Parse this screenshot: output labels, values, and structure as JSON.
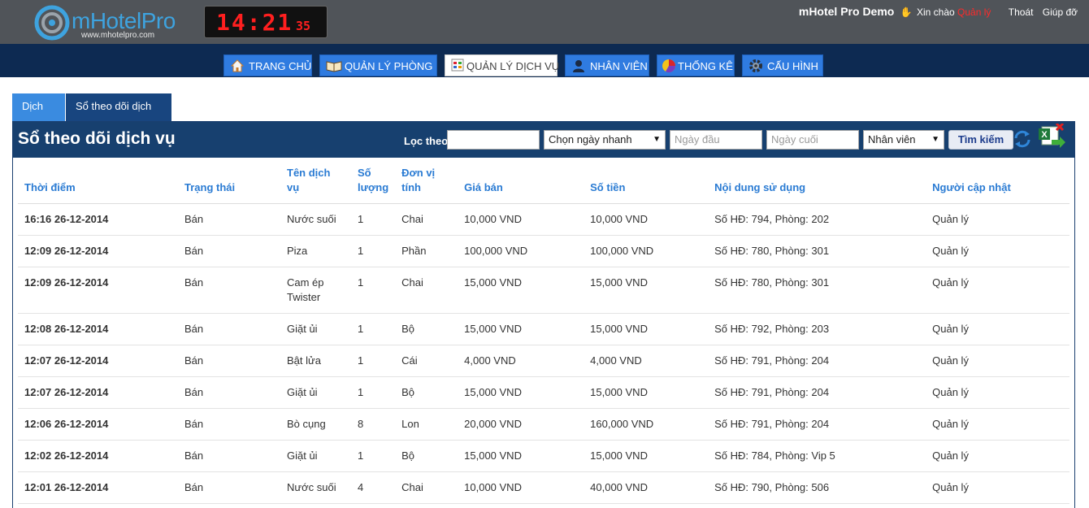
{
  "header": {
    "logo_text": "mHotelPro",
    "logo_sub": "www.mhotelpro.com",
    "clock_hm": "14:21",
    "clock_s": "35",
    "brand": "mHotel Pro Demo",
    "greeting": "Xin chào",
    "user": "Quản lý",
    "logout": "Thoát",
    "help": "Giúp đỡ"
  },
  "nav": {
    "items": [
      {
        "label": "TRANG CHỦ",
        "icon": "home-icon"
      },
      {
        "label": "QUẢN LÝ PHÒNG",
        "icon": "book-icon"
      },
      {
        "label": "QUẢN LÝ DỊCH VỤ",
        "icon": "service-icon"
      },
      {
        "label": "NHÂN VIÊN",
        "icon": "user-icon"
      },
      {
        "label": "THỐNG KÊ",
        "icon": "pie-chart-icon"
      },
      {
        "label": "CẤU HÌNH",
        "icon": "gear-icon"
      }
    ],
    "active": "QUẢN LÝ DỊCH VỤ"
  },
  "tabs": [
    {
      "label": "Dịch vụ"
    },
    {
      "label": "Sổ theo dõi dịch vụ"
    }
  ],
  "panel": {
    "title": "Sổ theo dõi dịch vụ",
    "filter_label": "Lọc theo:",
    "filter_value": "",
    "quick_date": "Chọn ngày nhanh",
    "start_placeholder": "Ngày đầu",
    "end_placeholder": "Ngày cuối",
    "staff": "Nhân viên",
    "search_label": "Tìm kiếm",
    "refresh_icon": "refresh-icon",
    "export_icon": "excel-export-icon"
  },
  "table": {
    "columns": [
      "Thời điểm",
      "Trạng thái",
      "Tên dịch vụ",
      "Số lượng",
      "Đơn vị tính",
      "Giá bán",
      "Số tiền",
      "Nội dung sử dụng",
      "Người cập nhật"
    ],
    "rows": [
      [
        "16:16 26-12-2014",
        "Bán",
        "Nước suối",
        "1",
        "Chai",
        "10,000 VND",
        "10,000 VND",
        "Số HĐ: 794, Phòng: 202",
        "Quản lý"
      ],
      [
        "12:09 26-12-2014",
        "Bán",
        "Piza",
        "1",
        "Phần",
        "100,000 VND",
        "100,000 VND",
        "Số HĐ: 780, Phòng: 301",
        "Quản lý"
      ],
      [
        "12:09 26-12-2014",
        "Bán",
        "Cam ép Twister",
        "1",
        "Chai",
        "15,000 VND",
        "15,000 VND",
        "Số HĐ: 780, Phòng: 301",
        "Quản lý"
      ],
      [
        "12:08 26-12-2014",
        "Bán",
        "Giặt ủi",
        "1",
        "Bộ",
        "15,000 VND",
        "15,000 VND",
        "Số HĐ: 792, Phòng: 203",
        "Quản lý"
      ],
      [
        "12:07 26-12-2014",
        "Bán",
        "Bật lửa",
        "1",
        "Cái",
        "4,000 VND",
        "4,000 VND",
        "Số HĐ: 791, Phòng: 204",
        "Quản lý"
      ],
      [
        "12:07 26-12-2014",
        "Bán",
        "Giặt ủi",
        "1",
        "Bộ",
        "15,000 VND",
        "15,000 VND",
        "Số HĐ: 791, Phòng: 204",
        "Quản lý"
      ],
      [
        "12:06 26-12-2014",
        "Bán",
        "Bò cụng",
        "8",
        "Lon",
        "20,000 VND",
        "160,000 VND",
        "Số HĐ: 791, Phòng: 204",
        "Quản lý"
      ],
      [
        "12:02 26-12-2014",
        "Bán",
        "Giặt ủi",
        "1",
        "Bộ",
        "15,000 VND",
        "15,000 VND",
        "Số HĐ: 784, Phòng: Vip 5",
        "Quản lý"
      ],
      [
        "12:01 26-12-2014",
        "Bán",
        "Nước suối",
        "4",
        "Chai",
        "10,000 VND",
        "40,000 VND",
        "Số HĐ: 790, Phòng: 506",
        "Quản lý"
      ]
    ]
  }
}
